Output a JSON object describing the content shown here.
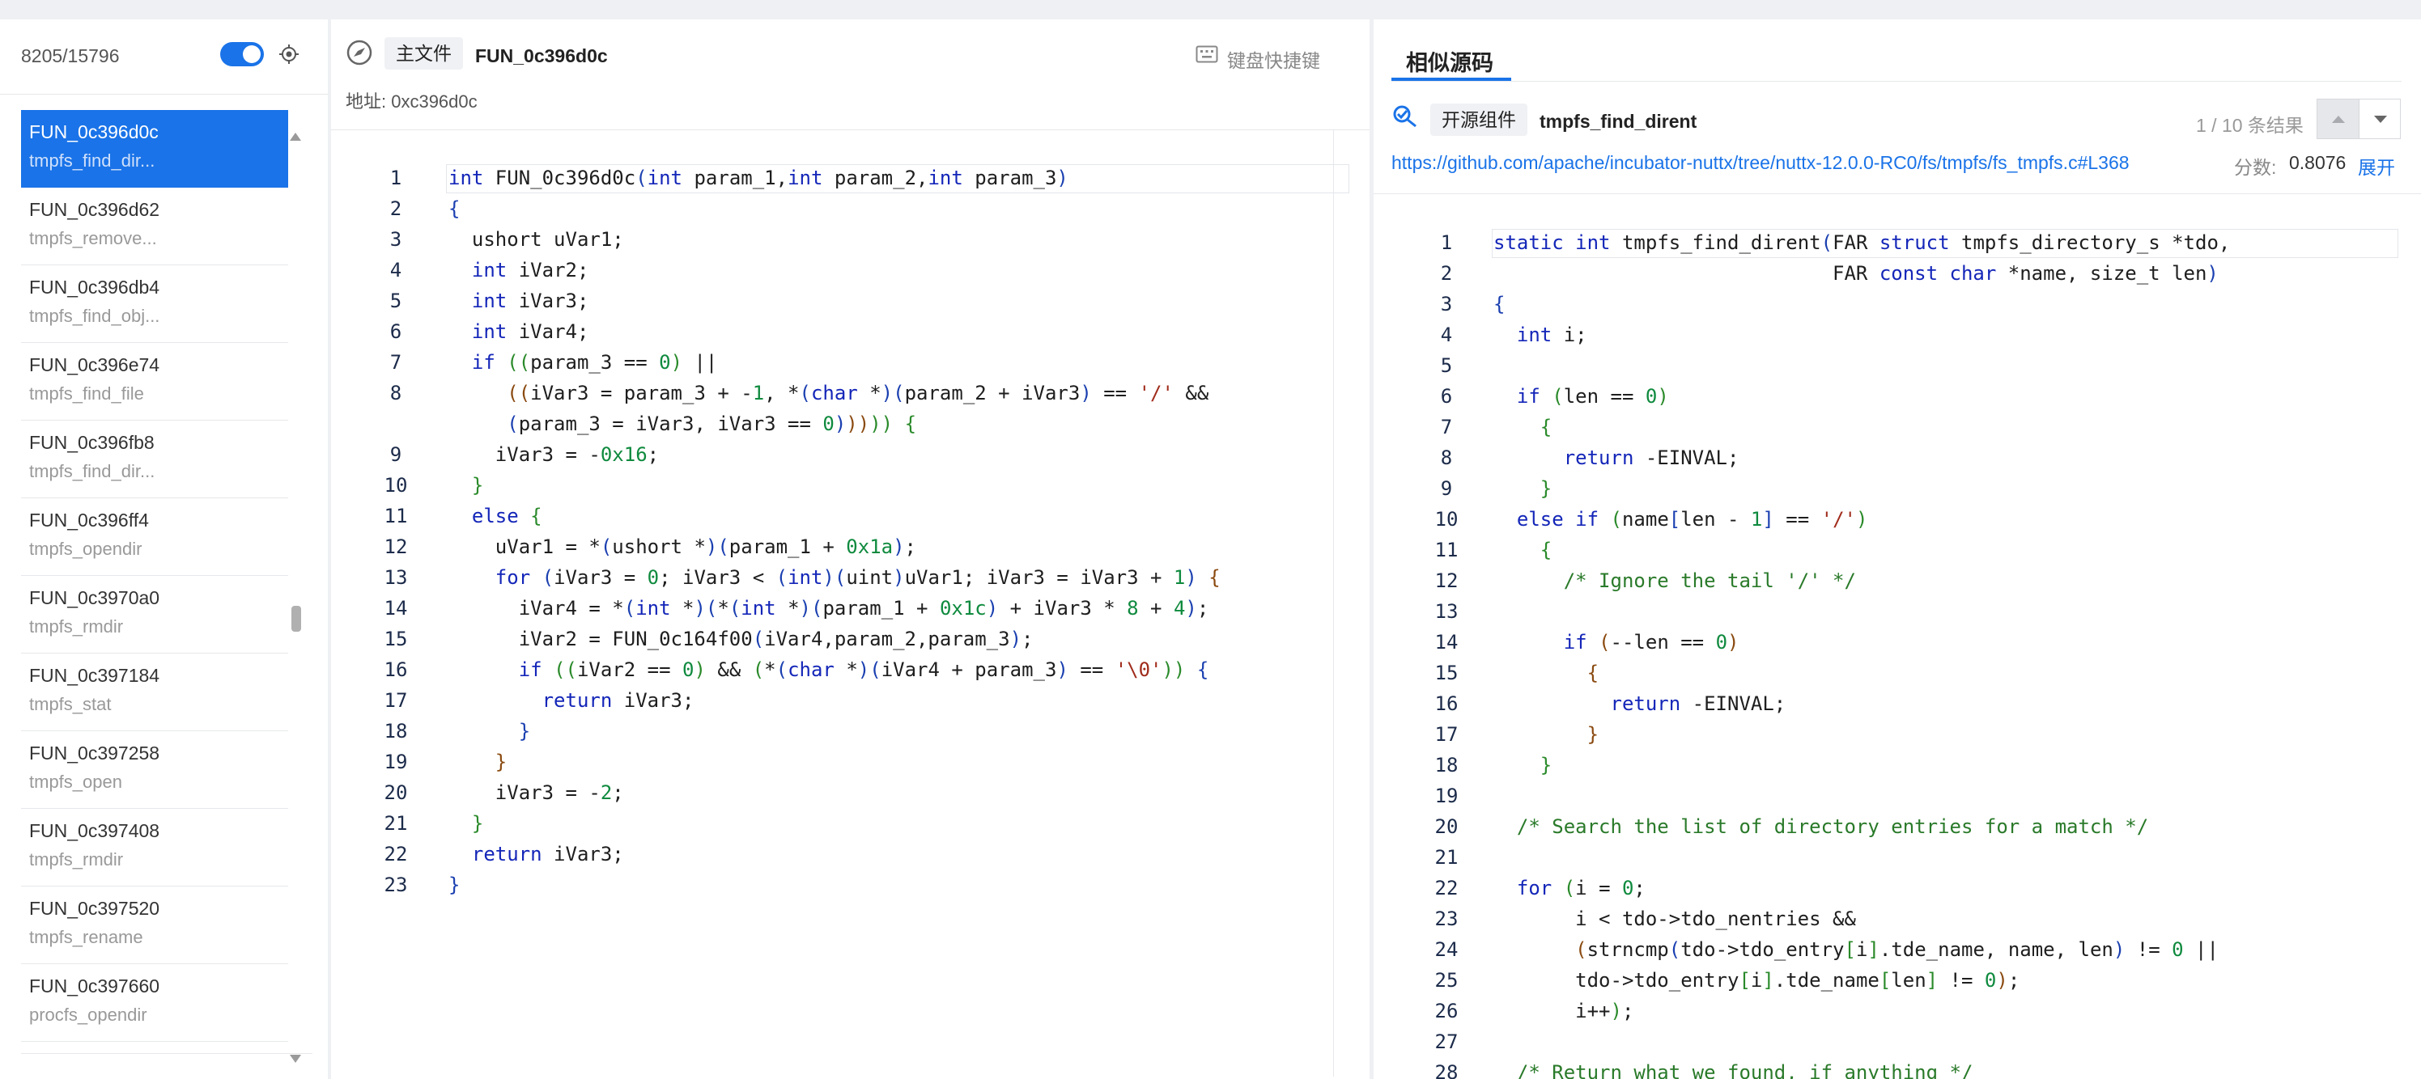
{
  "sidebar": {
    "count": "8205/15796",
    "items": [
      {
        "name": "FUN_0c396d0c",
        "sub": "tmpfs_find_dir..."
      },
      {
        "name": "FUN_0c396d62",
        "sub": "tmpfs_remove..."
      },
      {
        "name": "FUN_0c396db4",
        "sub": "tmpfs_find_obj..."
      },
      {
        "name": "FUN_0c396e74",
        "sub": "tmpfs_find_file"
      },
      {
        "name": "FUN_0c396fb8",
        "sub": "tmpfs_find_dir..."
      },
      {
        "name": "FUN_0c396ff4",
        "sub": "tmpfs_opendir"
      },
      {
        "name": "FUN_0c3970a0",
        "sub": "tmpfs_rmdir"
      },
      {
        "name": "FUN_0c397184",
        "sub": "tmpfs_stat"
      },
      {
        "name": "FUN_0c397258",
        "sub": "tmpfs_open"
      },
      {
        "name": "FUN_0c397408",
        "sub": "tmpfs_rmdir"
      },
      {
        "name": "FUN_0c397520",
        "sub": "tmpfs_rename"
      },
      {
        "name": "FUN_0c397660",
        "sub": "procfs_opendir"
      }
    ]
  },
  "main": {
    "tag": "主文件",
    "function_name": "FUN_0c396d0c",
    "address": "地址: 0xc396d0c",
    "keyboard_label": "键盘快捷键",
    "line_numbers": [
      "1",
      "2",
      "3",
      "4",
      "5",
      "6",
      "7",
      "8",
      "",
      "9",
      "10",
      "11",
      "12",
      "13",
      "14",
      "15",
      "16",
      "17",
      "18",
      "19",
      "20",
      "21",
      "22",
      "23"
    ]
  },
  "similar": {
    "tab_label": "相似源码",
    "tag": "开源组件",
    "function_name": "tmpfs_find_dirent",
    "result_count": "1 / 10 条结果",
    "url": "https://github.com/apache/incubator-nuttx/tree/nuttx-12.0.0-RC0/fs/tmpfs/fs_tmpfs.c#L368",
    "score_label": "分数:",
    "score_value": "0.8076",
    "expand_label": "展开",
    "line_numbers": [
      "1",
      "2",
      "3",
      "4",
      "5",
      "6",
      "7",
      "8",
      "9",
      "10",
      "11",
      "12",
      "13",
      "14",
      "15",
      "16",
      "17",
      "18",
      "19",
      "20",
      "21",
      "22",
      "23",
      "24",
      "25",
      "26",
      "27",
      "28"
    ]
  },
  "colors": {
    "accent": "#1a73e8",
    "keyword": "#1426b8",
    "number": "#0f8a3e",
    "string": "#a02c1b",
    "comment": "#2a7a2a"
  }
}
